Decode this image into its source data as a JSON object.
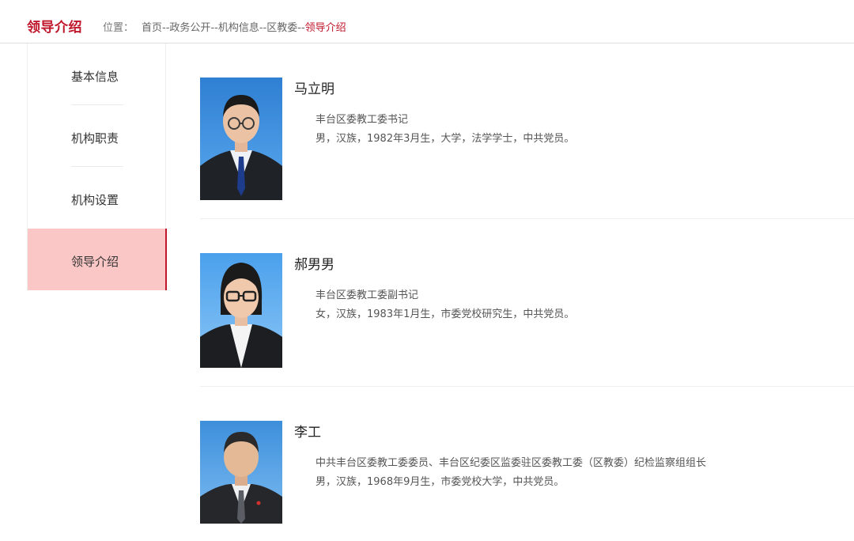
{
  "header": {
    "section_title": "领导介绍",
    "location_label": "位置：",
    "breadcrumb": [
      "首页",
      "政务公开",
      "机构信息",
      "区教委"
    ],
    "breadcrumb_current": "领导介绍",
    "separator": "--"
  },
  "sidebar": {
    "items": [
      {
        "label": "基本信息",
        "active": false
      },
      {
        "label": "机构职责",
        "active": false
      },
      {
        "label": "机构设置",
        "active": false
      },
      {
        "label": "领导介绍",
        "active": true
      }
    ]
  },
  "leaders": [
    {
      "name": "马立明",
      "position": "丰台区委教工委书记",
      "bio": "男，汉族，1982年3月生，大学，法学学士，中共党员。",
      "photo_icon": "portrait-photo"
    },
    {
      "name": "郝男男",
      "position": "丰台区委教工委副书记",
      "bio": "女，汉族，1983年1月生，市委党校研究生，中共党员。",
      "photo_icon": "portrait-photo"
    },
    {
      "name": "李工",
      "position": "中共丰台区委教工委委员、丰台区纪委区监委驻区委教工委（区教委）纪检监察组组长",
      "bio": "男，汉族，1968年9月生，市委党校大学，中共党员。",
      "photo_icon": "portrait-photo"
    }
  ],
  "colors": {
    "accent": "#c0162b",
    "active_bg": "#fbc6c6",
    "photo_bg_1": "#3a8fd8",
    "photo_bg_2": "#56a8ec",
    "photo_bg_3": "#4f9de0"
  }
}
